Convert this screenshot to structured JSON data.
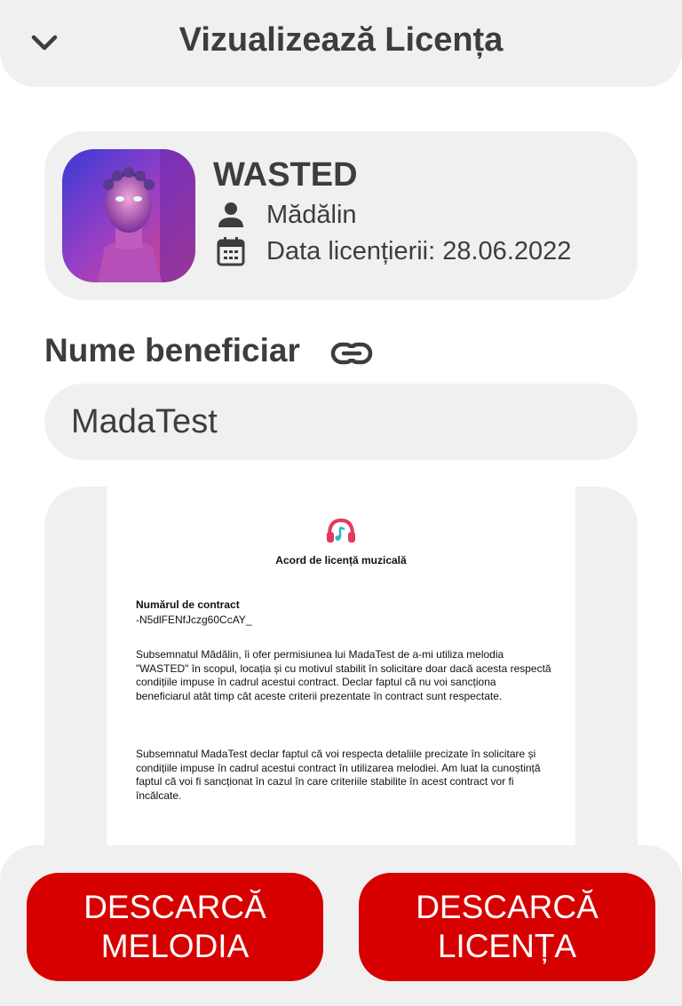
{
  "header": {
    "title": "Vizualizează Licența",
    "back_icon": "chevron-down-icon"
  },
  "track": {
    "title": "WASTED",
    "artist": "Mădălin",
    "license_date": "Data licențierii: 28.06.2022"
  },
  "beneficiary": {
    "label": "Nume beneficiar",
    "value": "MadaTest",
    "link_icon": "link-icon"
  },
  "document": {
    "title": "Acord de licență muzicală",
    "contract_label": "Numărul de contract",
    "contract_number": "-N5dlFENfJczg60CcAY_",
    "paragraph_1": "Subsemnatul Mădălin, îi ofer permisiunea lui MadaTest de a-mi utiliza melodia \"WASTED\" în scopul, locația și cu motivul stabilit în solicitare doar dacă acesta respectă condițiile impuse în cadrul acestui contract. Declar faptul că nu voi sancționa beneficiarul atât timp cât aceste criterii prezentate în contract sunt respectate.",
    "paragraph_2": "Subsemnatul MadaTest declar faptul că voi respecta detaliile precizate în solicitare și condițiile impuse în cadrul acestui contract în utilizarea melodiei. Am luat la cunoștință faptul că voi fi sancționat în cazul în care criteriile stabilite în acest contract vor fi încălcate."
  },
  "actions": {
    "download_song": [
      "DESCARCĂ",
      "MELODIA"
    ],
    "download_license": [
      "DESCARCĂ",
      "LICENȚA"
    ]
  },
  "colors": {
    "accent": "#d60000",
    "surface": "#f0f0f0",
    "text": "#3d3d3d"
  }
}
